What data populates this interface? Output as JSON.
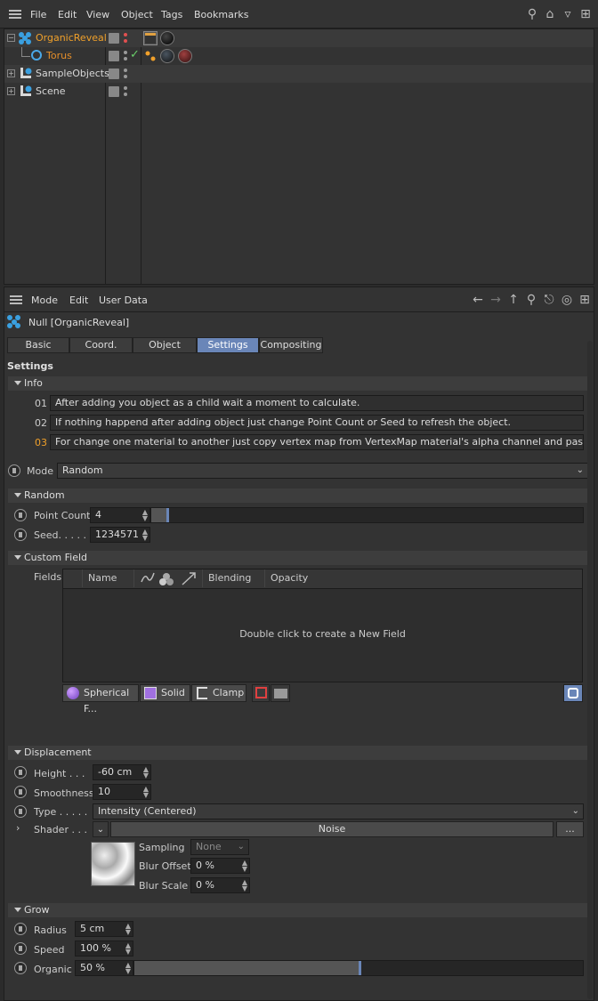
{
  "menubar": {
    "items": [
      "File",
      "Edit",
      "View",
      "Object",
      "Tags",
      "Bookmarks"
    ]
  },
  "objects": [
    {
      "name": "OrganicReveal",
      "color": "#f0a02a"
    },
    {
      "name": "Torus",
      "color": "#e58e2a"
    },
    {
      "name": "SampleObjects",
      "color": "#d8d8d8"
    },
    {
      "name": "Scene",
      "color": "#d8d8d8"
    }
  ],
  "attr_menubar": {
    "items": [
      "Mode",
      "Edit",
      "User Data"
    ]
  },
  "object_title": "Null [OrganicReveal]",
  "tabs": [
    "Basic",
    "Coord.",
    "Object",
    "Settings",
    "Compositing"
  ],
  "settings_title": "Settings",
  "info": {
    "title": "Info",
    "lines": [
      {
        "num": "01",
        "text": "After adding you object as a child wait a moment to calculate."
      },
      {
        "num": "02",
        "text": "If nothing happend after adding object just change Point Count or Seed to refresh the object."
      },
      {
        "num": "03",
        "text": "For change one material to another just copy vertex map from VertexMap material's alpha channel and paste to your material"
      }
    ]
  },
  "mode": {
    "label": "Mode",
    "value": "Random"
  },
  "random": {
    "title": "Random",
    "point_count_label": "Point Count",
    "point_count": "4",
    "seed_label": "Seed. . . . .",
    "seed": "1234571"
  },
  "custom_field": {
    "title": "Custom Field",
    "fields_label": "Fields",
    "headers": [
      "Name",
      "Blending",
      "Opacity"
    ],
    "empty_text": "Double click to create a New Field",
    "buttons": [
      "Spherical F...",
      "Solid",
      "Clamp"
    ]
  },
  "displacement": {
    "title": "Displacement",
    "height_label": "Height . . .",
    "height": "-60 cm",
    "smoothness_label": "Smoothness",
    "smoothness": "10",
    "type_label": "Type . . . . .",
    "type": "Intensity (Centered)",
    "shader_label": "Shader . . .",
    "shader": "Noise",
    "shader_more": "...",
    "sampling_label": "Sampling",
    "sampling": "None",
    "blur_offset_label": "Blur Offset",
    "blur_offset": "0 %",
    "blur_scale_label": "Blur Scale",
    "blur_scale": "0 %"
  },
  "grow": {
    "title": "Grow",
    "radius_label": "Radius",
    "radius": "5 cm",
    "speed_label": "Speed",
    "speed": "100 %",
    "organic_label": "Organic",
    "organic": "50 %",
    "organic_fraction": 0.5
  },
  "colors": {
    "accent": "#6a86b8",
    "highlight_orange": "#f0a02a"
  }
}
